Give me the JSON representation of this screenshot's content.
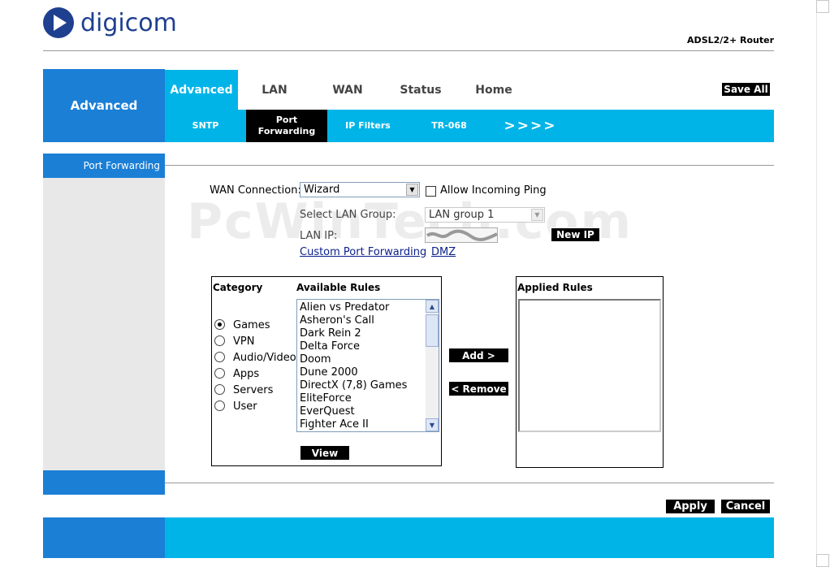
{
  "brand": {
    "logo_text": "digicom",
    "product": "ADSL2/2+ Router"
  },
  "nav": {
    "section_label": "Advanced",
    "tabs": [
      {
        "label": "Advanced"
      },
      {
        "label": "LAN"
      },
      {
        "label": "WAN"
      },
      {
        "label": "Status"
      },
      {
        "label": "Home"
      }
    ],
    "save_all": "Save All",
    "subtabs": [
      {
        "label": "SNTP"
      },
      {
        "label": "Port Forwarding"
      },
      {
        "label": "IP Filters"
      },
      {
        "label": "TR-068"
      },
      {
        "label": ">>>>"
      }
    ]
  },
  "sidebar": {
    "title": "Port Forwarding"
  },
  "watermark": "PcWinTech.com",
  "form": {
    "wan_connection_label": "WAN Connection:",
    "wan_connection_value": "Wizard",
    "allow_ping_label": "Allow Incoming Ping",
    "lan_group_label": "Select LAN Group:",
    "lan_group_value": "LAN group 1",
    "lan_ip_label": "LAN IP:",
    "new_ip": "New IP",
    "custom_pf_link": "Custom Port Forwarding",
    "dmz_link": "DMZ"
  },
  "rules": {
    "category_label": "Category",
    "available_label": "Available Rules",
    "applied_label": "Applied Rules",
    "categories": [
      "Games",
      "VPN",
      "Audio/Video",
      "Apps",
      "Servers",
      "User"
    ],
    "selected_category": "Games",
    "available": [
      "Alien vs Predator",
      "Asheron's Call",
      "Dark Rein 2",
      "Delta Force",
      "Doom",
      "Dune 2000",
      "DirectX (7,8) Games",
      "EliteForce",
      "EverQuest",
      "Fighter Ace II"
    ],
    "view": "View",
    "add": "Add >",
    "remove": "< Remove"
  },
  "actions": {
    "apply": "Apply",
    "cancel": "Cancel"
  },
  "colors": {
    "brand_blue": "#1f3f8f",
    "nav_blue": "#1b7fd6",
    "cyan": "#00b4e8"
  }
}
